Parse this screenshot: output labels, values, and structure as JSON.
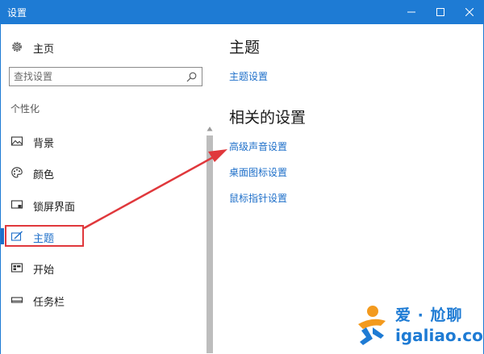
{
  "window": {
    "title": "设置",
    "controls": [
      "minimize",
      "maximize",
      "close"
    ]
  },
  "sidebar": {
    "home_label": "主页",
    "search": {
      "placeholder": "查找设置",
      "value": ""
    },
    "section_label": "个性化",
    "items": [
      {
        "label": "背景",
        "icon": "picture-icon",
        "active": false
      },
      {
        "label": "颜色",
        "icon": "palette-icon",
        "active": false
      },
      {
        "label": "锁屏界面",
        "icon": "lockscreen-icon",
        "active": false
      },
      {
        "label": "主题",
        "icon": "theme-brush-icon",
        "active": true
      },
      {
        "label": "开始",
        "icon": "start-menu-icon",
        "active": false
      },
      {
        "label": "任务栏",
        "icon": "taskbar-icon",
        "active": false
      }
    ]
  },
  "main": {
    "heading": "主题",
    "theme_settings_link": "主题设置",
    "related_heading": "相关的设置",
    "related_links": [
      "高级声音设置",
      "桌面图标设置",
      "鼠标指针设置"
    ]
  },
  "watermark": {
    "title": "爱 · 尬聊",
    "url": "igaliao.com"
  },
  "colors": {
    "titlebar": "#1e7bd4",
    "accent": "#1e6fc9",
    "annotation": "#e0383c"
  }
}
